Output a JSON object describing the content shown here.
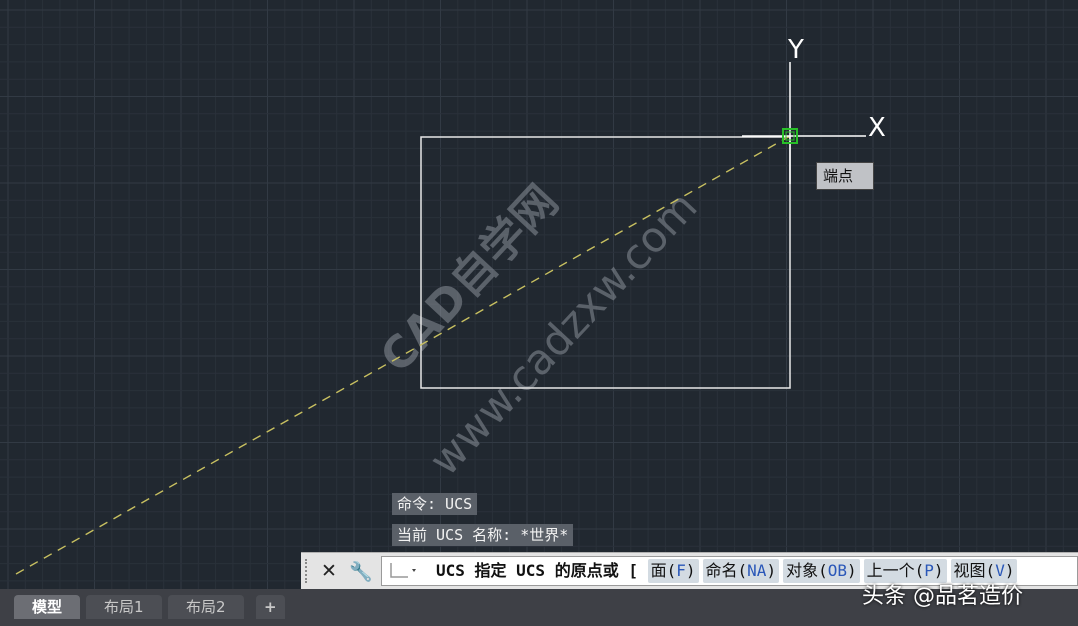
{
  "axis": {
    "y_label": "Y",
    "x_label": "X"
  },
  "snap_tooltip": "端点",
  "watermark": {
    "cn": "CAD自学网",
    "url": "www.cadzxw.com"
  },
  "history": [
    "命令: UCS",
    "当前 UCS 名称: *世界*"
  ],
  "command_line": {
    "prefix": "UCS 指定 UCS 的原点或 [",
    "options": [
      {
        "label": "面(",
        "key": "F",
        "close": ")"
      },
      {
        "label": "命名(",
        "key": "NA",
        "close": ")"
      },
      {
        "label": "对象(",
        "key": "OB",
        "close": ")"
      },
      {
        "label": "上一个(",
        "key": "P",
        "close": ")"
      },
      {
        "label": "视图(",
        "key": "V",
        "close": ")"
      }
    ]
  },
  "tabs": [
    "模型",
    "布局1",
    "布局2",
    "+"
  ],
  "corner_watermark": "头条 @品茗造价",
  "colors": {
    "background": "#212830",
    "grid_minor": "#2a313a",
    "grid_major": "#323a44",
    "snap_line": "#c8c060",
    "snap_marker": "#28c028"
  }
}
